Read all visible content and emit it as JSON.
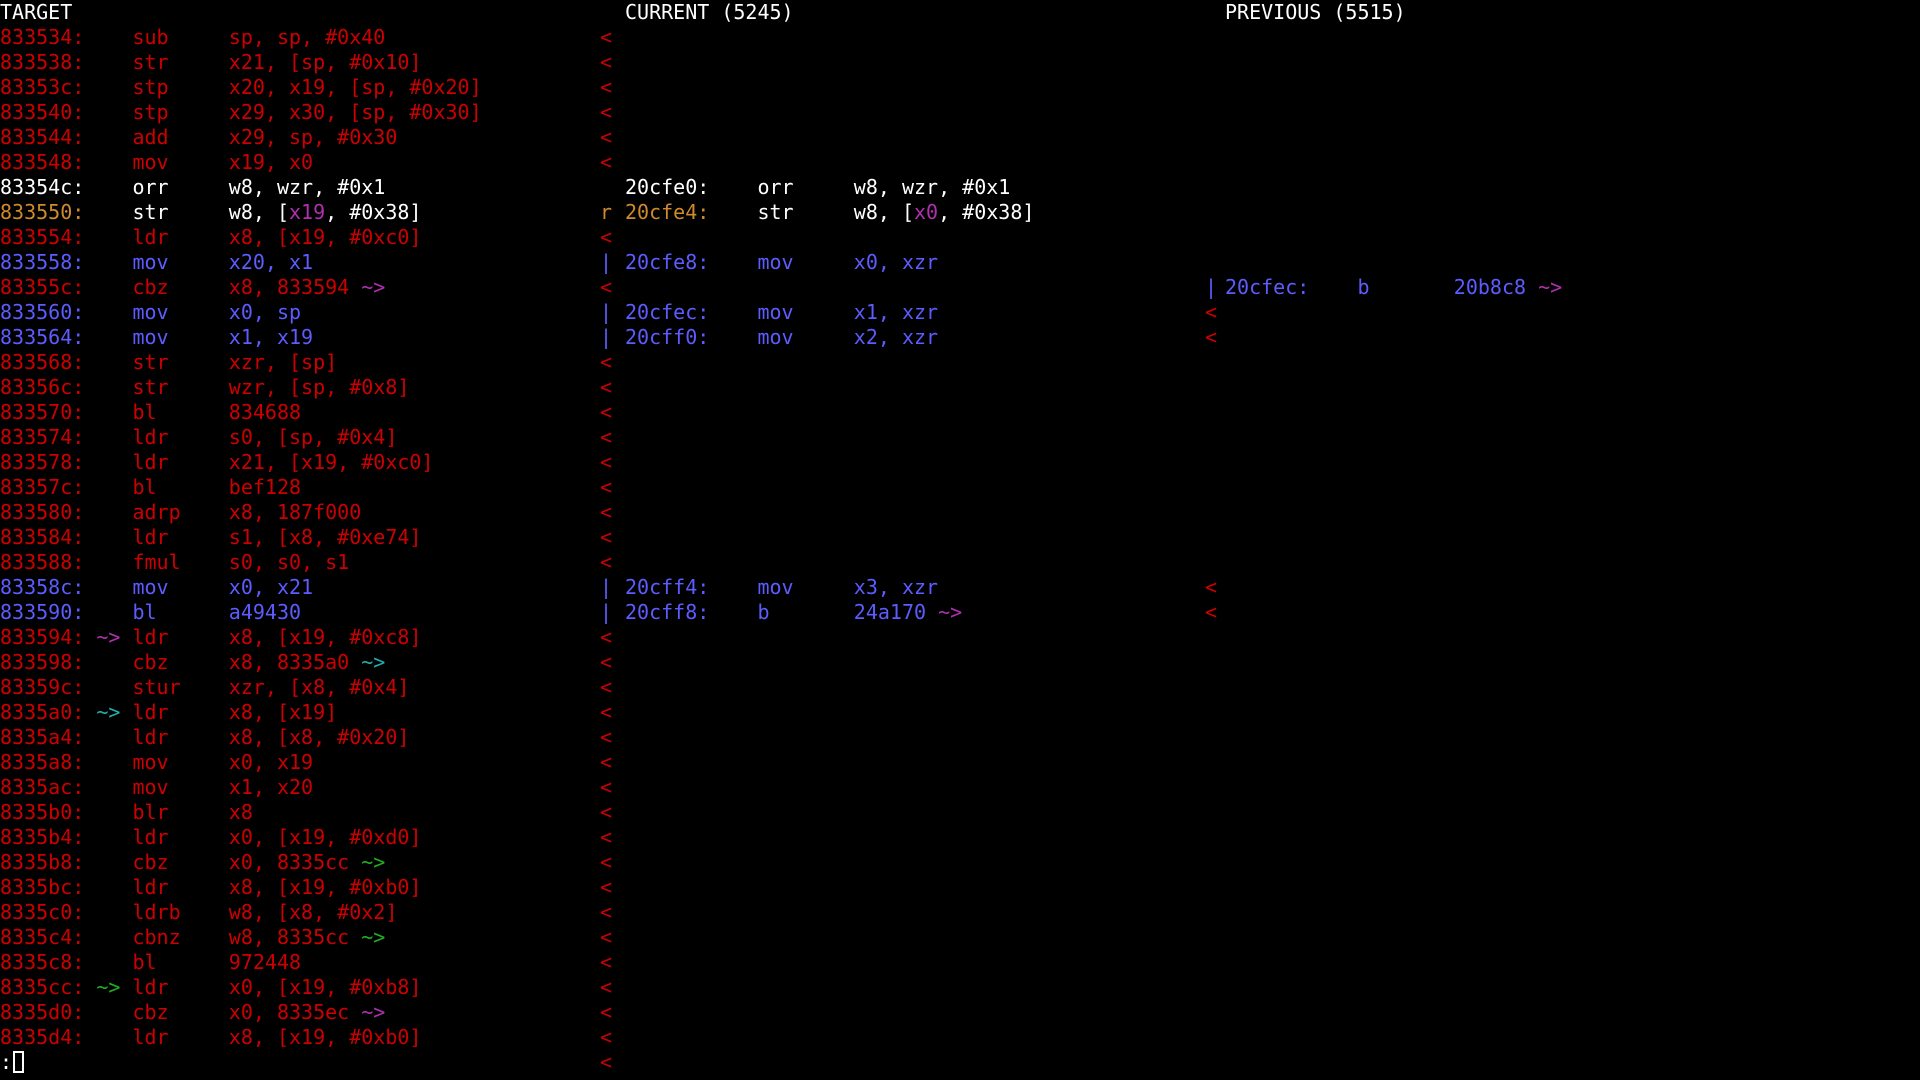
{
  "headers": {
    "target": "TARGET",
    "current": "CURRENT (5245)",
    "previous": "PREVIOUS (5515)"
  },
  "colors": {
    "background": "#000000",
    "white": "#ffffff",
    "removed": "#cc0000",
    "moved": "#5c5cff",
    "changed": "#d08a2a",
    "register_highlight": "#b030b0",
    "arrow_magenta": "#b030b0",
    "arrow_cyan": "#20b0b0",
    "arrow_green": "#20b020"
  },
  "target_rows": [
    {
      "c": "removed",
      "t": "833534:    sub     sp, sp, #0x40"
    },
    {
      "c": "removed",
      "t": "833538:    str     x21, [sp, #0x10]"
    },
    {
      "c": "removed",
      "t": "83353c:    stp     x20, x19, [sp, #0x20]"
    },
    {
      "c": "removed",
      "t": "833540:    stp     x29, x30, [sp, #0x30]"
    },
    {
      "c": "removed",
      "t": "833544:    add     x29, sp, #0x30"
    },
    {
      "c": "removed",
      "t": "833548:    mov     x19, x0"
    },
    {
      "c": "white",
      "t": "83354c:    orr     w8, wzr, #0x1"
    },
    {
      "segs": [
        {
          "c": "changed",
          "t": "833550:"
        },
        {
          "c": "white",
          "t": "    str     w8, ["
        },
        {
          "c": "register_highlight",
          "t": "x19"
        },
        {
          "c": "white",
          "t": ", #0x38]"
        }
      ]
    },
    {
      "c": "removed",
      "t": "833554:    ldr     x8, [x19, #0xc0]"
    },
    {
      "c": "moved",
      "t": "833558:    mov     x20, x1"
    },
    {
      "segs": [
        {
          "c": "removed",
          "t": "83355c:    cbz     x8, 833594 "
        },
        {
          "c": "arrow_magenta",
          "t": "~>"
        }
      ]
    },
    {
      "c": "moved",
      "t": "833560:    mov     x0, sp"
    },
    {
      "c": "moved",
      "t": "833564:    mov     x1, x19"
    },
    {
      "c": "removed",
      "t": "833568:    str     xzr, [sp]"
    },
    {
      "c": "removed",
      "t": "83356c:    str     wzr, [sp, #0x8]"
    },
    {
      "c": "removed",
      "t": "833570:    bl      834688"
    },
    {
      "c": "removed",
      "t": "833574:    ldr     s0, [sp, #0x4]"
    },
    {
      "c": "removed",
      "t": "833578:    ldr     x21, [x19, #0xc0]"
    },
    {
      "c": "removed",
      "t": "83357c:    bl      bef128"
    },
    {
      "c": "removed",
      "t": "833580:    adrp    x8, 187f000"
    },
    {
      "c": "removed",
      "t": "833584:    ldr     s1, [x8, #0xe74]"
    },
    {
      "c": "removed",
      "t": "833588:    fmul    s0, s0, s1"
    },
    {
      "c": "moved",
      "t": "83358c:    mov     x0, x21"
    },
    {
      "c": "moved",
      "t": "833590:    bl      a49430"
    },
    {
      "segs": [
        {
          "c": "removed",
          "t": "833594: "
        },
        {
          "c": "arrow_magenta",
          "t": "~>"
        },
        {
          "c": "removed",
          "t": " ldr     x8, [x19, #0xc8]"
        }
      ]
    },
    {
      "segs": [
        {
          "c": "removed",
          "t": "833598:    cbz     x8, 8335a0 "
        },
        {
          "c": "arrow_cyan",
          "t": "~>"
        }
      ]
    },
    {
      "c": "removed",
      "t": "83359c:    stur    xzr, [x8, #0x4]"
    },
    {
      "segs": [
        {
          "c": "removed",
          "t": "8335a0: "
        },
        {
          "c": "arrow_cyan",
          "t": "~>"
        },
        {
          "c": "removed",
          "t": " ldr     x8, [x19]"
        }
      ]
    },
    {
      "c": "removed",
      "t": "8335a4:    ldr     x8, [x8, #0x20]"
    },
    {
      "c": "removed",
      "t": "8335a8:    mov     x0, x19"
    },
    {
      "c": "removed",
      "t": "8335ac:    mov     x1, x20"
    },
    {
      "c": "removed",
      "t": "8335b0:    blr     x8"
    },
    {
      "c": "removed",
      "t": "8335b4:    ldr     x0, [x19, #0xd0]"
    },
    {
      "segs": [
        {
          "c": "removed",
          "t": "8335b8:    cbz     x0, 8335cc "
        },
        {
          "c": "arrow_green",
          "t": "~>"
        }
      ]
    },
    {
      "c": "removed",
      "t": "8335bc:    ldr     x8, [x19, #0xb0]"
    },
    {
      "c": "removed",
      "t": "8335c0:    ldrb    w8, [x8, #0x2]"
    },
    {
      "segs": [
        {
          "c": "removed",
          "t": "8335c4:    cbnz    w8, 8335cc "
        },
        {
          "c": "arrow_green",
          "t": "~>"
        }
      ]
    },
    {
      "c": "removed",
      "t": "8335c8:    bl      972448"
    },
    {
      "segs": [
        {
          "c": "removed",
          "t": "8335cc: "
        },
        {
          "c": "arrow_green",
          "t": "~>"
        },
        {
          "c": "removed",
          "t": " ldr     x0, [x19, #0xb8]"
        }
      ]
    },
    {
      "segs": [
        {
          "c": "removed",
          "t": "8335d0:    cbz     x0, 8335ec "
        },
        {
          "c": "arrow_magenta",
          "t": "~>"
        }
      ]
    },
    {
      "c": "removed",
      "t": "8335d4:    ldr     x8, [x19, #0xb0]"
    }
  ],
  "current_marks": [
    {
      "c": "removed",
      "t": "<"
    },
    {
      "c": "removed",
      "t": "<"
    },
    {
      "c": "removed",
      "t": "<"
    },
    {
      "c": "removed",
      "t": "<"
    },
    {
      "c": "removed",
      "t": "<"
    },
    {
      "c": "removed",
      "t": "<"
    },
    null,
    {
      "c": "changed",
      "t": "r"
    },
    {
      "c": "removed",
      "t": "<"
    },
    {
      "c": "moved",
      "t": "|"
    },
    {
      "c": "removed",
      "t": "<"
    },
    {
      "c": "moved",
      "t": "|"
    },
    {
      "c": "moved",
      "t": "|"
    },
    {
      "c": "removed",
      "t": "<"
    },
    {
      "c": "removed",
      "t": "<"
    },
    {
      "c": "removed",
      "t": "<"
    },
    {
      "c": "removed",
      "t": "<"
    },
    {
      "c": "removed",
      "t": "<"
    },
    {
      "c": "removed",
      "t": "<"
    },
    {
      "c": "removed",
      "t": "<"
    },
    {
      "c": "removed",
      "t": "<"
    },
    {
      "c": "removed",
      "t": "<"
    },
    {
      "c": "moved",
      "t": "|"
    },
    {
      "c": "moved",
      "t": "|"
    },
    {
      "c": "removed",
      "t": "<"
    },
    {
      "c": "removed",
      "t": "<"
    },
    {
      "c": "removed",
      "t": "<"
    },
    {
      "c": "removed",
      "t": "<"
    },
    {
      "c": "removed",
      "t": "<"
    },
    {
      "c": "removed",
      "t": "<"
    },
    {
      "c": "removed",
      "t": "<"
    },
    {
      "c": "removed",
      "t": "<"
    },
    {
      "c": "removed",
      "t": "<"
    },
    {
      "c": "removed",
      "t": "<"
    },
    {
      "c": "removed",
      "t": "<"
    },
    {
      "c": "removed",
      "t": "<"
    },
    {
      "c": "removed",
      "t": "<"
    },
    {
      "c": "removed",
      "t": "<"
    },
    {
      "c": "removed",
      "t": "<"
    },
    {
      "c": "removed",
      "t": "<"
    },
    {
      "c": "removed",
      "t": "<"
    },
    {
      "c": "removed",
      "t": "<"
    }
  ],
  "current_rows": [
    null,
    null,
    null,
    null,
    null,
    null,
    {
      "c": "white",
      "t": "20cfe0:    orr     w8, wzr, #0x1"
    },
    {
      "segs": [
        {
          "c": "changed",
          "t": "20cfe4:"
        },
        {
          "c": "white",
          "t": "    str     w8, ["
        },
        {
          "c": "register_highlight",
          "t": "x0"
        },
        {
          "c": "white",
          "t": ", #0x38]"
        }
      ]
    },
    null,
    {
      "c": "moved",
      "t": "20cfe8:    mov     x0, xzr"
    },
    null,
    {
      "c": "moved",
      "t": "20cfec:    mov     x1, xzr"
    },
    {
      "c": "moved",
      "t": "20cff0:    mov     x2, xzr"
    },
    null,
    null,
    null,
    null,
    null,
    null,
    null,
    null,
    null,
    {
      "c": "moved",
      "t": "20cff4:    mov     x3, xzr"
    },
    {
      "segs": [
        {
          "c": "moved",
          "t": "20cff8:    b       24a170 "
        },
        {
          "c": "arrow_magenta",
          "t": "~>"
        }
      ]
    },
    null,
    null,
    null,
    null,
    null,
    null,
    null,
    null,
    null,
    null,
    null,
    null,
    null,
    null,
    null,
    null,
    null,
    null
  ],
  "previous_marks": [
    null,
    null,
    null,
    null,
    null,
    null,
    null,
    null,
    null,
    null,
    {
      "c": "moved",
      "t": "|"
    },
    {
      "c": "removed",
      "t": "<"
    },
    {
      "c": "removed",
      "t": "<"
    },
    null,
    null,
    null,
    null,
    null,
    null,
    null,
    null,
    null,
    {
      "c": "removed",
      "t": "<"
    },
    {
      "c": "removed",
      "t": "<"
    },
    null,
    null,
    null,
    null,
    null,
    null,
    null,
    null,
    null,
    null,
    null,
    null,
    null,
    null,
    null,
    null,
    null,
    null
  ],
  "previous_rows": [
    null,
    null,
    null,
    null,
    null,
    null,
    null,
    null,
    null,
    null,
    {
      "segs": [
        {
          "c": "moved",
          "t": "20cfec:    b       20b8c8 "
        },
        {
          "c": "arrow_magenta",
          "t": "~>"
        }
      ]
    },
    null,
    null,
    null,
    null,
    null,
    null,
    null,
    null,
    null,
    null,
    null,
    null,
    null,
    null,
    null,
    null,
    null,
    null,
    null,
    null,
    null,
    null,
    null,
    null,
    null,
    null,
    null,
    null,
    null,
    null,
    null
  ],
  "prompt": ":"
}
